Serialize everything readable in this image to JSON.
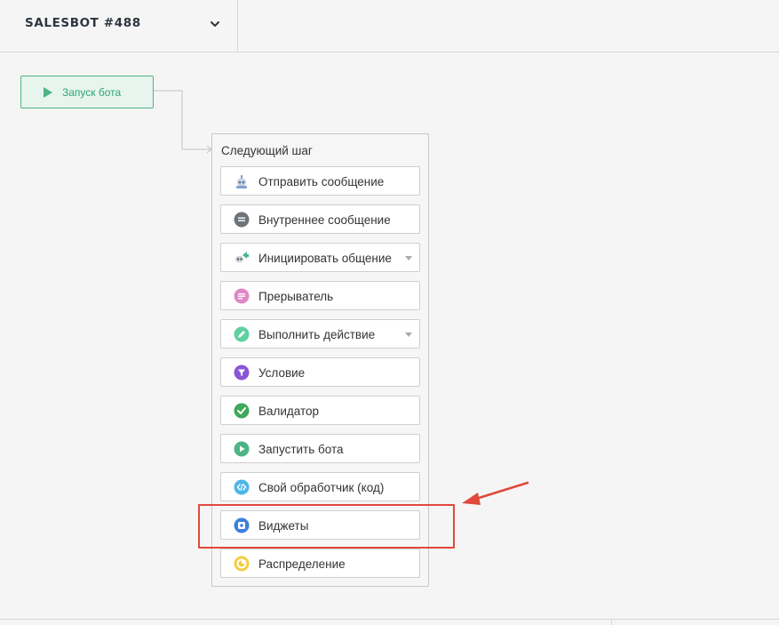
{
  "header": {
    "title": "SALESBOT #488",
    "dropdown_icon": "chevron-down-icon"
  },
  "start_node": {
    "label": "Запуск бота",
    "icon": "play-icon",
    "color": "#4cb585"
  },
  "panel": {
    "title": "Следующий шаг",
    "steps": [
      {
        "label": "Отправить сообщение",
        "icon": "robot-message-icon",
        "has_dropdown": false
      },
      {
        "label": "Внутреннее сообщение",
        "icon": "chat-bubble-icon",
        "has_dropdown": false
      },
      {
        "label": "Инициировать общение",
        "icon": "robot-initiate-icon",
        "has_dropdown": true
      },
      {
        "label": "Прерыватель",
        "icon": "breaker-message-icon",
        "has_dropdown": false
      },
      {
        "label": "Выполнить действие",
        "icon": "pencil-icon",
        "has_dropdown": true
      },
      {
        "label": "Условие",
        "icon": "funnel-icon",
        "has_dropdown": false
      },
      {
        "label": "Валидатор",
        "icon": "checkmark-icon",
        "has_dropdown": false
      },
      {
        "label": "Запустить бота",
        "icon": "play-circle-icon",
        "has_dropdown": false
      },
      {
        "label": "Свой обработчик (код)",
        "icon": "code-icon",
        "has_dropdown": false
      },
      {
        "label": "Виджеты",
        "icon": "widget-plus-icon",
        "has_dropdown": false
      },
      {
        "label": "Распределение",
        "icon": "distribution-icon",
        "has_dropdown": false
      }
    ]
  },
  "annotation": {
    "highlight_color": "#e0493b",
    "highlighted_step": "Виджеты"
  }
}
